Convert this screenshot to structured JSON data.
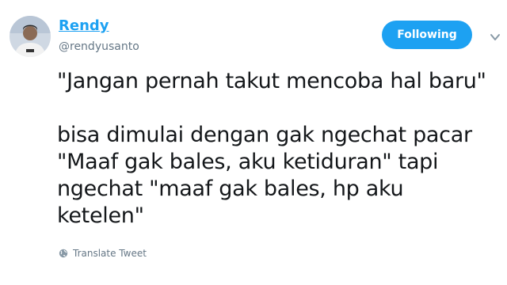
{
  "user": {
    "name": "Rendy",
    "handle": "@rendyusanto"
  },
  "follow_button": {
    "label": "Following"
  },
  "tweet": {
    "lines_part1": [
      "\"Jangan pernah takut mencoba hal baru\""
    ],
    "lines_part2": [
      "bisa dimulai dengan gak ngechat pacar",
      "\"Maaf gak bales, aku ketiduran\" tapi",
      "ngechat \"maaf gak bales, hp aku",
      "ketelen\""
    ]
  },
  "translate": {
    "label": "Translate Tweet",
    "icon": "globe-icon"
  },
  "colors": {
    "accent": "#1da1f2",
    "secondary_text": "#657786",
    "text": "#14171a"
  }
}
